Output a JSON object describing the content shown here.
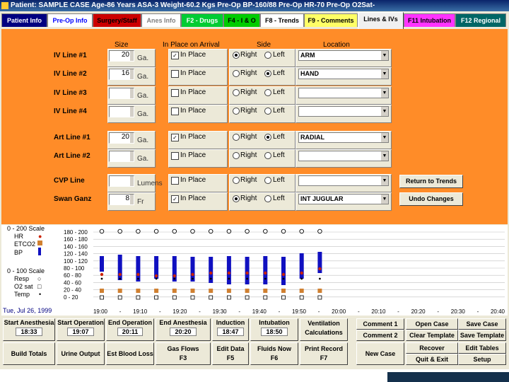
{
  "title": "Patient: SAMPLE CASE   Age-86 Years   ASA-3   Weight-60.2 Kgs   Pre-Op BP-160/88   Pre-Op HR-70   Pre-Op O2Sat-",
  "tabs": [
    {
      "label": "Patient Info",
      "bg": "#000080",
      "fg": "#ffffff"
    },
    {
      "label": "Pre-Op Info",
      "bg": "#ffffff",
      "fg": "#0000ff"
    },
    {
      "label": "Surgery/Staff",
      "bg": "#cc0000",
      "fg": "#000000"
    },
    {
      "label": "Anes Info",
      "bg": "#ffffff",
      "fg": "#808080"
    },
    {
      "label": "F2 - Drugs",
      "bg": "#00cc33",
      "fg": "#ffffff"
    },
    {
      "label": "F4 - I & O",
      "bg": "#00cc00",
      "fg": "#000000"
    },
    {
      "label": "F8 - Trends",
      "bg": "#ffffff",
      "fg": "#000000"
    },
    {
      "label": "F9 - Comments",
      "bg": "#ffff66",
      "fg": "#000000"
    },
    {
      "label": "Lines & IVs",
      "bg": "#f0f0f0",
      "fg": "#000000"
    },
    {
      "label": "F11 Intubation",
      "bg": "#ff33ff",
      "fg": "#000000"
    },
    {
      "label": "F12 Regional",
      "bg": "#006666",
      "fg": "#ffffff"
    }
  ],
  "headers": {
    "size": "Size",
    "in_place": "In Place on Arrival",
    "side": "Side",
    "location": "Location"
  },
  "lines": [
    {
      "label": "IV Line #1",
      "size": "20",
      "unit": "Ga.",
      "in_place": true,
      "side": "Right",
      "location": "ARM"
    },
    {
      "label": "IV Line #2",
      "size": "16",
      "unit": "Ga.",
      "in_place": false,
      "side": "Left",
      "location": "HAND"
    },
    {
      "label": "IV Line #3",
      "size": "",
      "unit": "Ga.",
      "in_place": false,
      "side": "",
      "location": ""
    },
    {
      "label": "IV Line #4",
      "size": "",
      "unit": "Ga.",
      "in_place": false,
      "side": "",
      "location": ""
    },
    {
      "label": "Art Line #1",
      "size": "20",
      "unit": "Ga.",
      "in_place": true,
      "side": "Left",
      "location": "RADIAL"
    },
    {
      "label": "Art Line #2",
      "size": "",
      "unit": "Ga.",
      "in_place": false,
      "side": "",
      "location": ""
    },
    {
      "label": "CVP Line",
      "size": "",
      "unit": "Lumens",
      "in_place": false,
      "side": "",
      "location": ""
    },
    {
      "label": "Swan Ganz",
      "size": "8",
      "unit": "Fr",
      "in_place": true,
      "side": "Right",
      "location": "INT JUGULAR"
    }
  ],
  "in_place_label": "In Place",
  "right_label": "Right",
  "left_label": "Left",
  "buttons": {
    "return_trends": "Return to Trends",
    "undo": "Undo Changes"
  },
  "legend": {
    "scale1": "0 - 200 Scale",
    "hr": "HR",
    "etco2": "ETCO2",
    "bp": "BP",
    "scale2": "0 - 100 Scale",
    "resp": "Resp",
    "o2sat": "O2 sat",
    "temp": "Temp",
    "date": "Tue, Jul 26, 1999"
  },
  "chart_data": {
    "type": "line",
    "y_labels": [
      "180 - 200",
      "160 - 180",
      "140 - 160",
      "120 - 140",
      "100 - 120",
      "80 - 100",
      "60 - 80",
      "40 - 60",
      "20 - 40",
      "0 - 20"
    ],
    "x_labels": [
      "19:00",
      "-",
      "19:10",
      "-",
      "19:20",
      "-",
      "19:30",
      "-",
      "19:40",
      "-",
      "19:50",
      "-",
      "20:00",
      "-",
      "20:10",
      "-",
      "20:20",
      "-",
      "20:30",
      "-",
      "20:40"
    ],
    "colors": {
      "bp": "#1010c0",
      "hr": "#cc2200",
      "etco2": "#d08030",
      "o2sat": "#000000",
      "temp": "#000000"
    },
    "columns": 13
  },
  "bottom": {
    "start_anesthesia": {
      "label": "Start Anesthesia",
      "value": "18:33"
    },
    "start_operation": {
      "label": "Start Operation",
      "value": "19:07"
    },
    "end_operation": {
      "label": "End Operation",
      "value": "20:11"
    },
    "end_anesthesia": {
      "label": "End Anesthesia",
      "value": "20:20"
    },
    "induction": {
      "label": "Induction",
      "value": "18:47"
    },
    "intubation": {
      "label": "Intubation",
      "value": "18:50"
    },
    "ventilation": "Ventilation Calculations",
    "comment1": "Comment 1",
    "comment2": "Comment 2",
    "open_case": "Open Case",
    "clear_template": "Clear Template",
    "save_case": "Save Case",
    "save_template": "Save Template",
    "build_totals": "Build Totals",
    "urine_output": "Urine Output",
    "est_blood_loss": "Est Blood Loss",
    "gas_flows": "Gas Flows",
    "gas_flows_key": "F3",
    "edit_data": "Edit Data",
    "edit_data_key": "F5",
    "fluids_now": "Fluids Now",
    "fluids_now_key": "F6",
    "print_record": "Print Record",
    "print_record_key": "F7",
    "new_case": "New Case",
    "recover": "Recover",
    "edit_tables": "Edit Tables",
    "quit_exit": "Quit & Exit",
    "setup": "Setup"
  }
}
